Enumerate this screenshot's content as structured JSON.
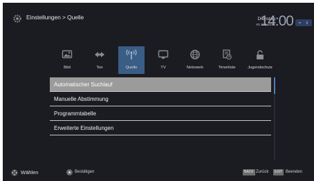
{
  "header": {
    "breadcrumb": "Einstellungen > Quelle",
    "day": "Dienstag",
    "date": "xx xxx xxxx",
    "time": "14:00"
  },
  "icons": {
    "header": "gear-icon",
    "tabs": [
      "picture-icon",
      "sound-icon",
      "antenna-icon",
      "tv-icon",
      "globe-icon",
      "timer-list-icon",
      "lock-icon"
    ]
  },
  "tabs": [
    {
      "label": "Bild"
    },
    {
      "label": "Ton"
    },
    {
      "label": "Quelle"
    },
    {
      "label": "TV"
    },
    {
      "label": "Netzwerk"
    },
    {
      "label": "Timerliste"
    },
    {
      "label": "Jugendschutz"
    }
  ],
  "menu": {
    "items": [
      {
        "label": "Automatischer Suchlauf"
      },
      {
        "label": "Manuelle Abstimmung"
      },
      {
        "label": "Programmtabelle"
      },
      {
        "label": "Erweiterte Einstellungen"
      }
    ]
  },
  "footer": {
    "select_label": "Wählen",
    "ok_label": "Bestätigen",
    "back_key": "BACK",
    "back_label": "Zurück",
    "exit_key": "EXIT",
    "exit_label": "Beenden"
  },
  "colors": {
    "background": "#1b1b22",
    "active_tab": "#3a5d86",
    "selected_item": "#9b9b9b",
    "accent": "#4c7fb8"
  }
}
